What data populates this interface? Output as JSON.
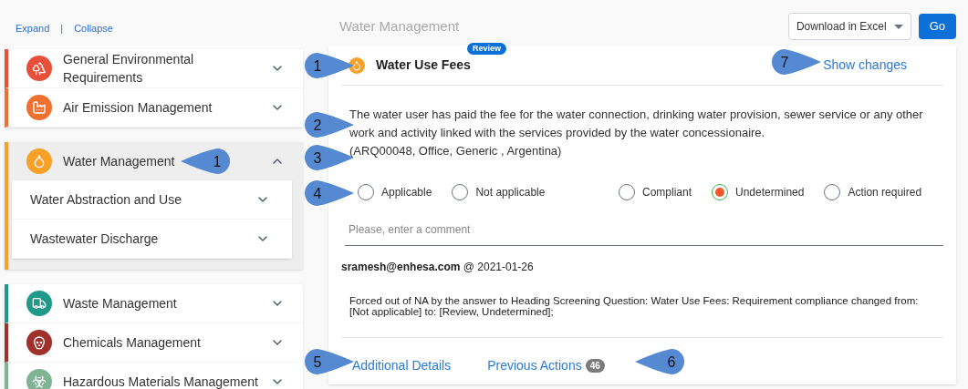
{
  "sidebar": {
    "expand_link": "Expand",
    "separator": "|",
    "collapse_link": "Collapse",
    "groups": [
      {
        "items": [
          {
            "label": "General Environmental Requirements",
            "color": "#e8503a",
            "expanded": false
          },
          {
            "label": "Air Emission Management",
            "color": "#f07030",
            "expanded": false
          }
        ]
      },
      {
        "items": [
          {
            "label": "Water Management",
            "color": "#f7a128",
            "expanded": true,
            "children": [
              {
                "label": "Water Abstraction and Use",
                "expanded": false
              },
              {
                "label": "Wastewater Discharge",
                "expanded": false
              }
            ]
          }
        ]
      },
      {
        "items": [
          {
            "label": "Waste Management",
            "color": "#20998a",
            "expanded": false
          },
          {
            "label": "Chemicals Management",
            "color": "#a0302a",
            "expanded": false
          },
          {
            "label": "Hazardous Materials Management",
            "color": "#7fb394",
            "expanded": false
          }
        ]
      }
    ]
  },
  "header": {
    "title": "Water Management",
    "export_select": "Download in Excel",
    "go_button": "Go"
  },
  "requirement": {
    "title": "Water Use Fees",
    "badge": "Review",
    "show_changes": "Show changes",
    "text": "The water user has paid the fee for the water connection, drinking water provision, sewer service or any other work and activity linked with the services provided by the water concessionaire.",
    "reference": "(ARQ00048, Office, Generic , Argentina)",
    "applicability": [
      {
        "label": "Applicable",
        "selected": false
      },
      {
        "label": "Not applicable",
        "selected": false
      }
    ],
    "compliance": [
      {
        "label": "Compliant",
        "selected": false
      },
      {
        "label": "Undetermined",
        "selected": true
      },
      {
        "label": "Action required",
        "selected": false
      }
    ],
    "comment": {
      "placeholder": "Please, enter a comment"
    },
    "log": {
      "author": "sramesh@enhesa.com",
      "date": "@ 2021-01-26",
      "message": "Forced out of NA by the answer to Heading Screening Question: Water Use Fees: Requirement compliance changed from: [Not applicable] to: [Review, Undetermined];"
    },
    "additional_details": "Additional Details",
    "previous_actions": "Previous Actions",
    "previous_count": "46"
  },
  "callouts": [
    {
      "label": "1"
    },
    {
      "label": "1"
    },
    {
      "label": "2"
    },
    {
      "label": "3"
    },
    {
      "label": "4"
    },
    {
      "label": "5"
    },
    {
      "label": "6"
    },
    {
      "label": "7"
    }
  ]
}
